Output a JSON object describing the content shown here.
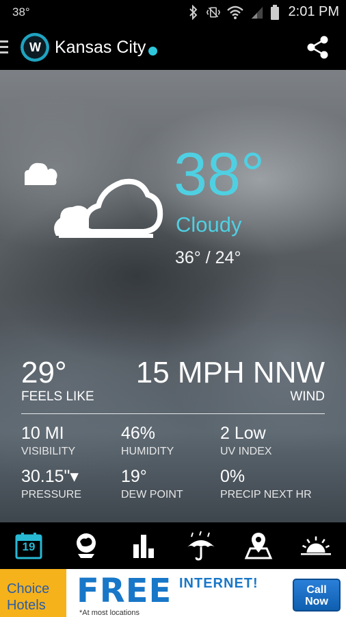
{
  "status_bar": {
    "temp": "38°",
    "time": "2:01 PM"
  },
  "app_bar": {
    "logo_text": "W",
    "city": "Kansas City"
  },
  "current": {
    "temperature": "38°",
    "condition": "Cloudy",
    "hi_lo": "36° / 24°",
    "feels_like_value": "29°",
    "feels_like_label": "FEELS LIKE",
    "wind_value": "15 MPH NNW",
    "wind_label": "WIND"
  },
  "stats": [
    {
      "value": "10 MI",
      "label": "VISIBILITY"
    },
    {
      "value": "46%",
      "label": "HUMIDITY"
    },
    {
      "value": "2 Low",
      "label": "UV INDEX"
    },
    {
      "value": "30.15\"▾",
      "label": "PRESSURE"
    },
    {
      "value": "19°",
      "label": "DEW POINT"
    },
    {
      "value": "0%",
      "label": "PRECIP NEXT HR"
    }
  ],
  "nav": {
    "calendar_day": "19",
    "active_color": "#27b9d4"
  },
  "ad": {
    "brand_line1": "Choice",
    "brand_line2": "Hotels",
    "headline": "FREE",
    "headline2": "INTERNET!",
    "subtext": "*At most locations",
    "cta_line1": "Call",
    "cta_line2": "Now"
  },
  "colors": {
    "accent": "#4fd0e2",
    "background": "#000000"
  }
}
